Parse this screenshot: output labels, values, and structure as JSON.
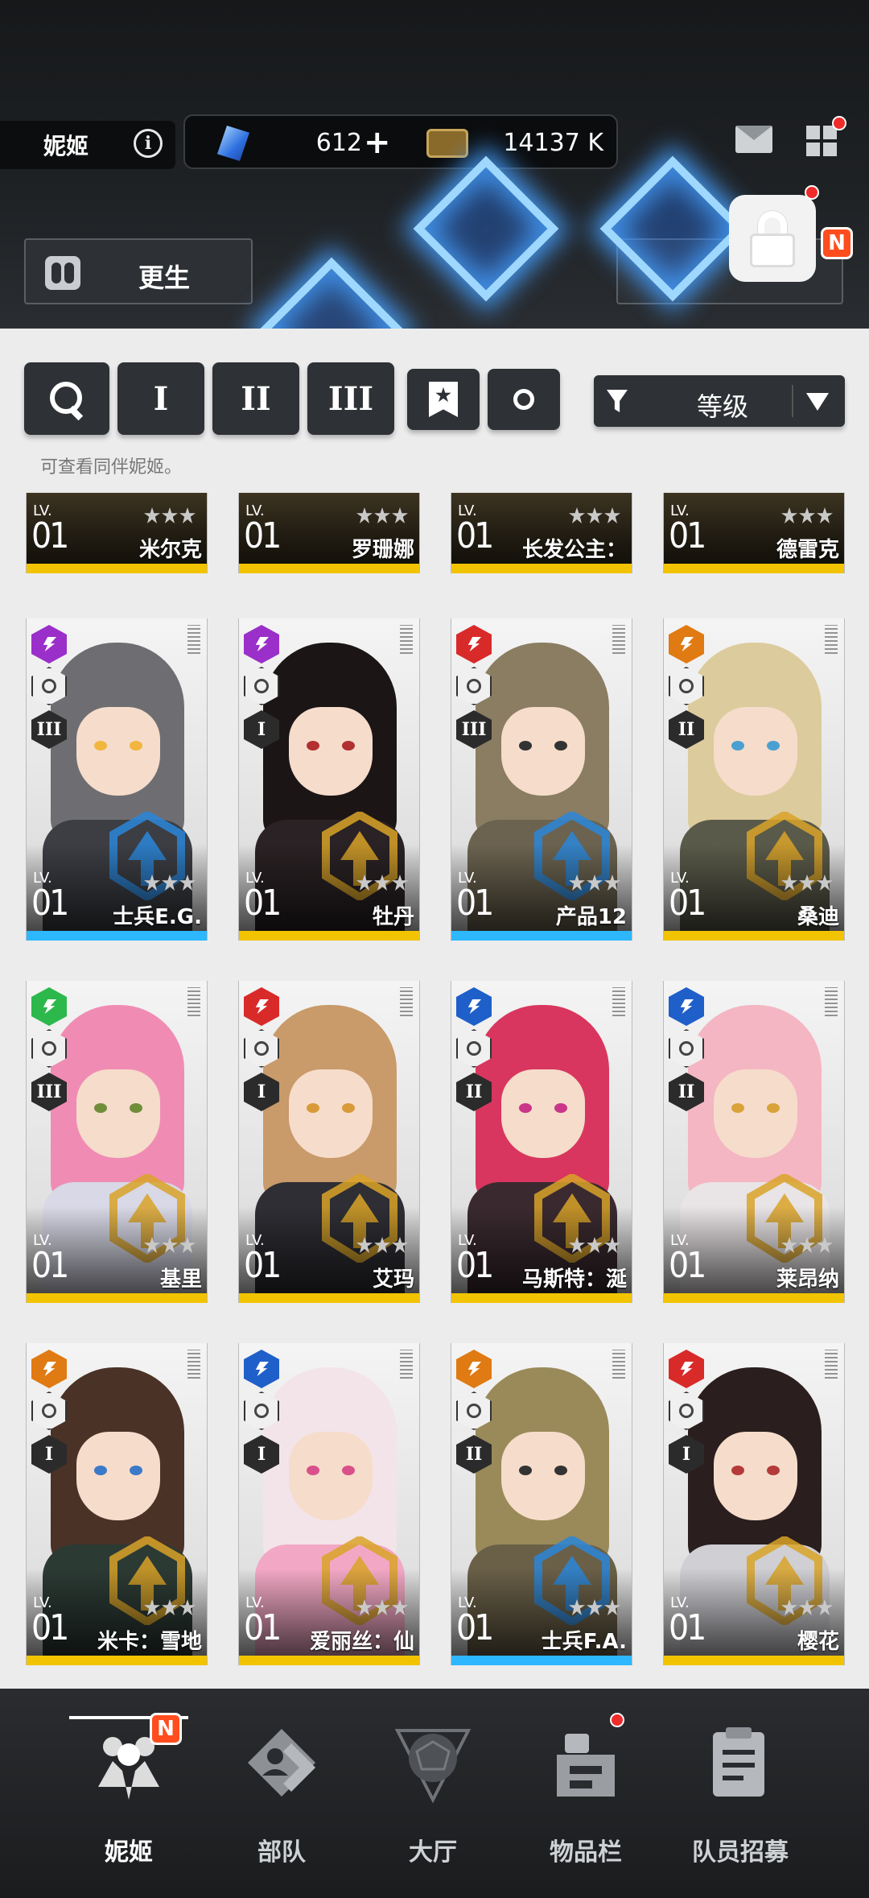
{
  "header": {
    "title": "妮姬",
    "info_icon": "i",
    "gems": "612",
    "gems_plus": "+",
    "credits": "14137 K",
    "rebirth_label": "更生",
    "n_badge": "N"
  },
  "filters": {
    "tier_1": "I",
    "tier_2": "II",
    "tier_3": "III",
    "bookmark_glyph": "★",
    "sort_label": "等级",
    "hint": "可查看同伴妮姬。"
  },
  "lv_label": "LV.",
  "partial_row": [
    {
      "name": "米尔克",
      "lv": "01",
      "bar": "#f2c300"
    },
    {
      "name": "罗珊娜",
      "lv": "01",
      "bar": "#f2c300"
    },
    {
      "name": "长发公主：",
      "lv": "01",
      "bar": "#f2c300"
    },
    {
      "name": "德雷克",
      "lv": "01",
      "bar": "#f2c300"
    }
  ],
  "cards": [
    {
      "name": "士兵E.G.",
      "lv": "01",
      "elem_color": "#9b2fc9",
      "burst": "III",
      "bar": "#2db7ff",
      "hair": "#6e6e72",
      "body": "#3c3e44",
      "eye": "#f2b640",
      "emblem": "#2a86d9"
    },
    {
      "name": "牡丹",
      "lv": "01",
      "elem_color": "#9b2fc9",
      "burst": "I",
      "bar": "#f2c300",
      "hair": "#1b1516",
      "body": "#2a2224",
      "eye": "#b23030",
      "emblem": "#d9a328"
    },
    {
      "name": "产品12",
      "lv": "01",
      "elem_color": "#d92a2a",
      "burst": "III",
      "bar": "#2db7ff",
      "hair": "#8a7d62",
      "body": "#6b6350",
      "eye": "#333333",
      "emblem": "#2a86d9"
    },
    {
      "name": "桑迪",
      "lv": "01",
      "elem_color": "#e07a12",
      "burst": "II",
      "bar": "#f2c300",
      "hair": "#dccb9c",
      "body": "#5a5a4a",
      "eye": "#4aa0d0",
      "emblem": "#d9a328"
    },
    {
      "name": "基里",
      "lv": "01",
      "elem_color": "#2db84c",
      "burst": "III",
      "bar": "#f2c300",
      "hair": "#f08cb4",
      "body": "#d8d8e6",
      "eye": "#6f8e3a",
      "emblem": "#d9a328"
    },
    {
      "name": "艾玛",
      "lv": "01",
      "elem_color": "#d92a2a",
      "burst": "I",
      "bar": "#f2c300",
      "hair": "#c99a6a",
      "body": "#2e2e34",
      "eye": "#d99a3a",
      "emblem": "#d9a328"
    },
    {
      "name": "马斯特：涎",
      "lv": "01",
      "elem_color": "#1f5fc9",
      "burst": "II",
      "bar": "#f2c300",
      "hair": "#d8365e",
      "body": "#3a2a30",
      "eye": "#c9368a",
      "emblem": "#d9a328"
    },
    {
      "name": "莱昂纳",
      "lv": "01",
      "elem_color": "#1f5fc9",
      "burst": "II",
      "bar": "#f2c300",
      "hair": "#f4b6c2",
      "body": "#e9e4e6",
      "eye": "#d9a33a",
      "emblem": "#d9a328"
    },
    {
      "name": "米卡：雪地",
      "lv": "01",
      "elem_color": "#e07a12",
      "burst": "I",
      "bar": "#f2c300",
      "hair": "#4a3226",
      "body": "#2c3a34",
      "eye": "#3a7ac9",
      "emblem": "#d9a328"
    },
    {
      "name": "爱丽丝：仙",
      "lv": "01",
      "elem_color": "#1f5fc9",
      "burst": "I",
      "bar": "#f2c300",
      "hair": "#f3e4ea",
      "body": "#f2a8c4",
      "eye": "#d9508a",
      "emblem": "#d9a328"
    },
    {
      "name": "士兵F.A.",
      "lv": "01",
      "elem_color": "#e07a12",
      "burst": "II",
      "bar": "#2db7ff",
      "hair": "#9a8a5a",
      "body": "#6a6048",
      "eye": "#333333",
      "emblem": "#2a86d9"
    },
    {
      "name": "樱花",
      "lv": "01",
      "elem_color": "#d92a2a",
      "burst": "I",
      "bar": "#f2c300",
      "hair": "#2a1e1e",
      "body": "#cfcfd4",
      "eye": "#b53a3a",
      "emblem": "#d9a328"
    }
  ],
  "nav": [
    {
      "label": "妮姬",
      "icon": "nikke-icon"
    },
    {
      "label": "部队",
      "icon": "squad-icon"
    },
    {
      "label": "大厅",
      "icon": "lobby-icon"
    },
    {
      "label": "物品栏",
      "icon": "inventory-icon"
    },
    {
      "label": "队员招募",
      "icon": "recruit-icon"
    }
  ]
}
